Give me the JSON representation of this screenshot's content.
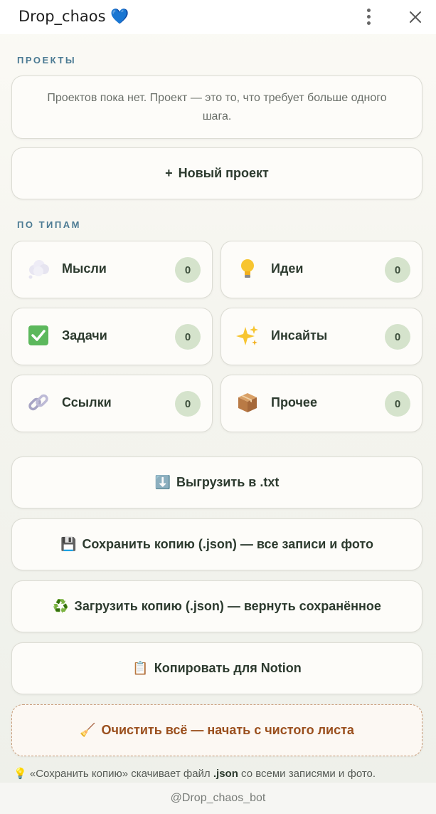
{
  "header": {
    "title": "Drop_chaos",
    "title_emoji": "💙",
    "menu_icon": "kebab-icon",
    "close_icon": "close-icon"
  },
  "projects": {
    "section_label": "ПРОЕКТЫ",
    "empty_text": "Проектов пока нет. Проект — это то, что требует больше одного шага.",
    "new_button_plus": "+",
    "new_button_label": "Новый проект"
  },
  "types": {
    "section_label": "ПО ТИПАМ",
    "items": [
      {
        "label": "Мысли",
        "count": "0",
        "icon": "thought-cloud-icon"
      },
      {
        "label": "Идеи",
        "count": "0",
        "icon": "lightbulb-icon"
      },
      {
        "label": "Задачи",
        "count": "0",
        "icon": "check-box-icon"
      },
      {
        "label": "Инсайты",
        "count": "0",
        "icon": "sparkles-icon"
      },
      {
        "label": "Ссылки",
        "count": "0",
        "icon": "link-icon"
      },
      {
        "label": "Прочее",
        "count": "0",
        "icon": "package-icon"
      }
    ]
  },
  "actions": {
    "export_txt_emoji": "⬇️",
    "export_txt": "Выгрузить в .txt",
    "save_json_emoji": "💾",
    "save_json": "Сохранить копию (.json) — все записи и фото",
    "load_json_emoji": "♻️",
    "load_json": "Загрузить копию (.json) — вернуть сохранённое",
    "notion_emoji": "📋",
    "notion": "Копировать для Notion",
    "clear_emoji": "🧹",
    "clear": "Очистить всё — начать с чистого листа"
  },
  "hint": {
    "emoji": "💡",
    "before": "«Сохранить копию» скачивает файл ",
    "bold": ".json",
    "after": " со всеми записями и фото."
  },
  "footer": {
    "text": "@Drop_chaos_bot"
  },
  "colors": {
    "accent_label": "#4b7a93",
    "count_badge": "#d5e3cc",
    "danger_text": "#9a4f1d"
  }
}
